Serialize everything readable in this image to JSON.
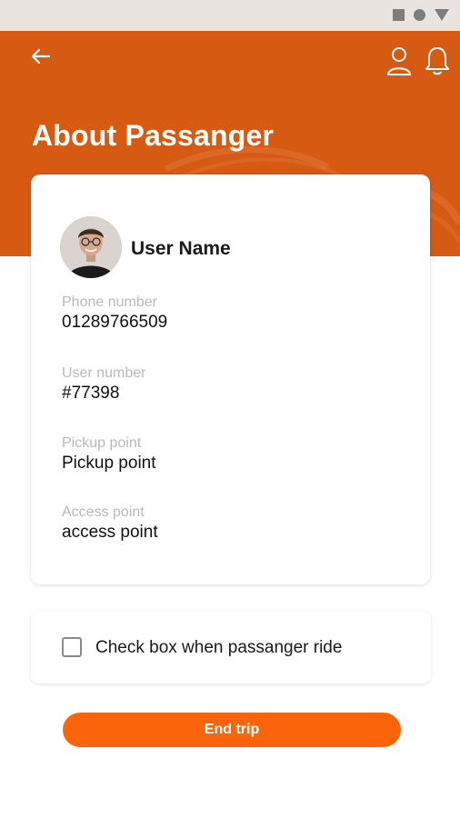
{
  "header": {
    "title": "About Passanger",
    "back_icon": "arrow-left-icon",
    "profile_icon": "user-icon",
    "bell_icon": "bell-icon",
    "background_color": "#d65a12"
  },
  "passenger": {
    "name": "User Name",
    "avatar_icon": "user-avatar",
    "fields": [
      {
        "label": "Phone number",
        "value": "01289766509"
      },
      {
        "label": "User number",
        "value": "#77398"
      },
      {
        "label": "Pickup point",
        "value": "Pickup point"
      },
      {
        "label": "Access point",
        "value": "access point"
      }
    ]
  },
  "ride_check": {
    "label": "Check box when passanger ride",
    "checked": false
  },
  "actions": {
    "end_trip_label": "End trip",
    "accent_color": "#fb640b"
  }
}
